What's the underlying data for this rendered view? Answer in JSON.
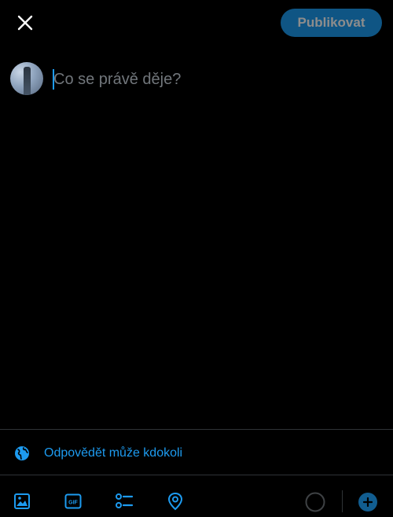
{
  "header": {
    "publish_label": "Publikovat"
  },
  "composer": {
    "placeholder": "Co se právě děje?",
    "value": ""
  },
  "reply_settings": {
    "label": "Odpovědět může kdokoli"
  },
  "toolbar": {
    "icons": [
      "image-icon",
      "gif-icon",
      "poll-icon",
      "location-icon",
      "character-progress-ring",
      "add-thread-icon"
    ],
    "character_progress": 0
  },
  "colors": {
    "accent": "#1d9bf0",
    "background": "#000000",
    "placeholder": "#71767b",
    "divider": "#2f3336"
  }
}
